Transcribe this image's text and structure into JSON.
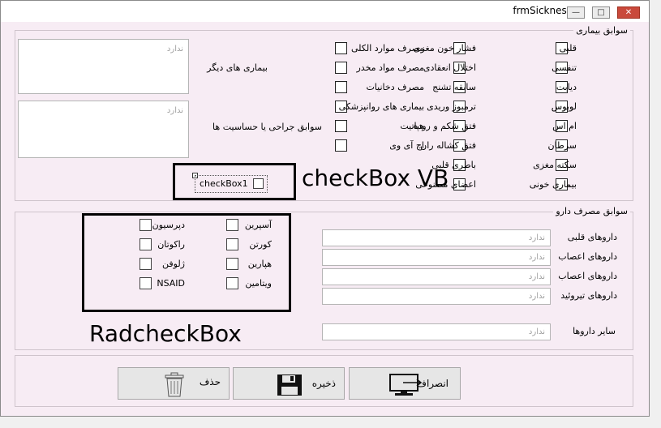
{
  "window": {
    "title": "frmSickness"
  },
  "history": {
    "group_label": "سوابق بیماری",
    "col1": [
      "قلبی",
      "تنفسی",
      "دیابت",
      "لوپوس",
      "ام اس",
      "سرطان",
      "سکته مغزی",
      "بیماری خونی"
    ],
    "col2": [
      "فشار خون مغزی",
      "اختلال انعقادی",
      "سابقه تشنج",
      "ترمبوز وریدی",
      "فتق شکم و روده",
      "فتق کشاله ران",
      "باطری قلبی",
      "اعضای مصنوعی"
    ],
    "col3": [
      "مصرف موارد الکلی",
      "مصرف مواد مخدر",
      "مصرف دخانیات",
      "بیماری های روانپزشکی",
      "هپاتیت",
      "اچ آی وی"
    ],
    "other_diseases_label": "بیماری های دیگر",
    "surgery_label": "سوابق جراحی یا حساسیت ها",
    "textarea_placeholder": "ندارد",
    "checkbox1_label": "checkBox1"
  },
  "annotations": {
    "vb": "checkBox VB",
    "rad": "RadcheckBox"
  },
  "drugs": {
    "group_label": "سوابق مصرف دارو",
    "rad_right": [
      "آسپرین",
      "کورتن",
      "هپارین",
      "ویتامین"
    ],
    "rad_left": [
      "دپرسیون",
      "راکوتان",
      "ژلوفن",
      "NSAID"
    ],
    "field_labels": [
      "داروهای قلبی",
      "داروهای اعصاب",
      "داروهای اعصاب",
      "داروهای تیروئید"
    ],
    "field_placeholder": "ندارد",
    "other_label": "سایر داروها"
  },
  "buttons": {
    "cancel": "انصراف",
    "save": "ذخیره",
    "delete": "حذف"
  }
}
